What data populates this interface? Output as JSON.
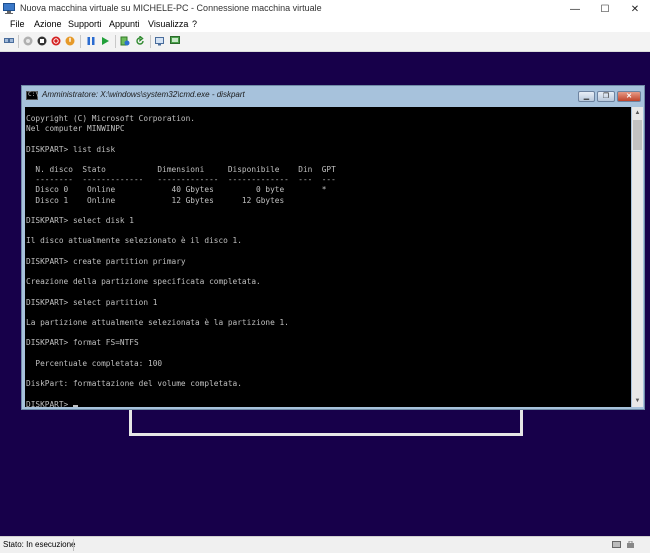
{
  "window": {
    "title": "Nuova macchina virtuale su MICHELE-PC - Connessione macchina virtuale",
    "minimize": "—",
    "maximize": "☐",
    "close": "✕"
  },
  "menu": [
    "File",
    "Azione",
    "Supporti",
    "Appunti",
    "Visualizza",
    "?"
  ],
  "toolbar": {
    "icons": [
      "ctrl-alt-del-icon",
      "start-icon",
      "turn-off-icon",
      "shutdown-icon",
      "power-icon",
      "pause-icon",
      "resume-icon",
      "checkpoint-icon",
      "revert-icon",
      "enhanced-session-icon"
    ]
  },
  "cmd": {
    "title": "Amministratore: X:\\windows\\system32\\cmd.exe - diskpart",
    "icon_text": "C:\\",
    "minimize": "▁",
    "restore": "❐",
    "close": "✕",
    "lines": [
      "Copyright (C) Microsoft Corporation.",
      "Nel computer MINWINPC",
      "",
      "DISKPART> list disk",
      "",
      "  N. disco  Stato           Dimensioni     Disponibile    Din  GPT",
      "  --------  -------------   -------------  -------------  ---  ---",
      "  Disco 0    Online            40 Gbytes         0 byte        *",
      "  Disco 1    Online            12 Gbytes      12 Gbytes",
      "",
      "DISKPART> select disk 1",
      "",
      "Il disco attualmente selezionato è il disco 1.",
      "",
      "DISKPART> create partition primary",
      "",
      "Creazione della partizione specificata completata.",
      "",
      "DISKPART> select partition 1",
      "",
      "La partizione attualmente selezionata è la partizione 1.",
      "",
      "DISKPART> format FS=NTFS",
      "",
      "  Percentuale completata: 100",
      "",
      "DiskPart: formattazione del volume completata.",
      ""
    ],
    "prompt": "DISKPART> "
  },
  "status": {
    "text": "Stato: In esecuzione"
  }
}
